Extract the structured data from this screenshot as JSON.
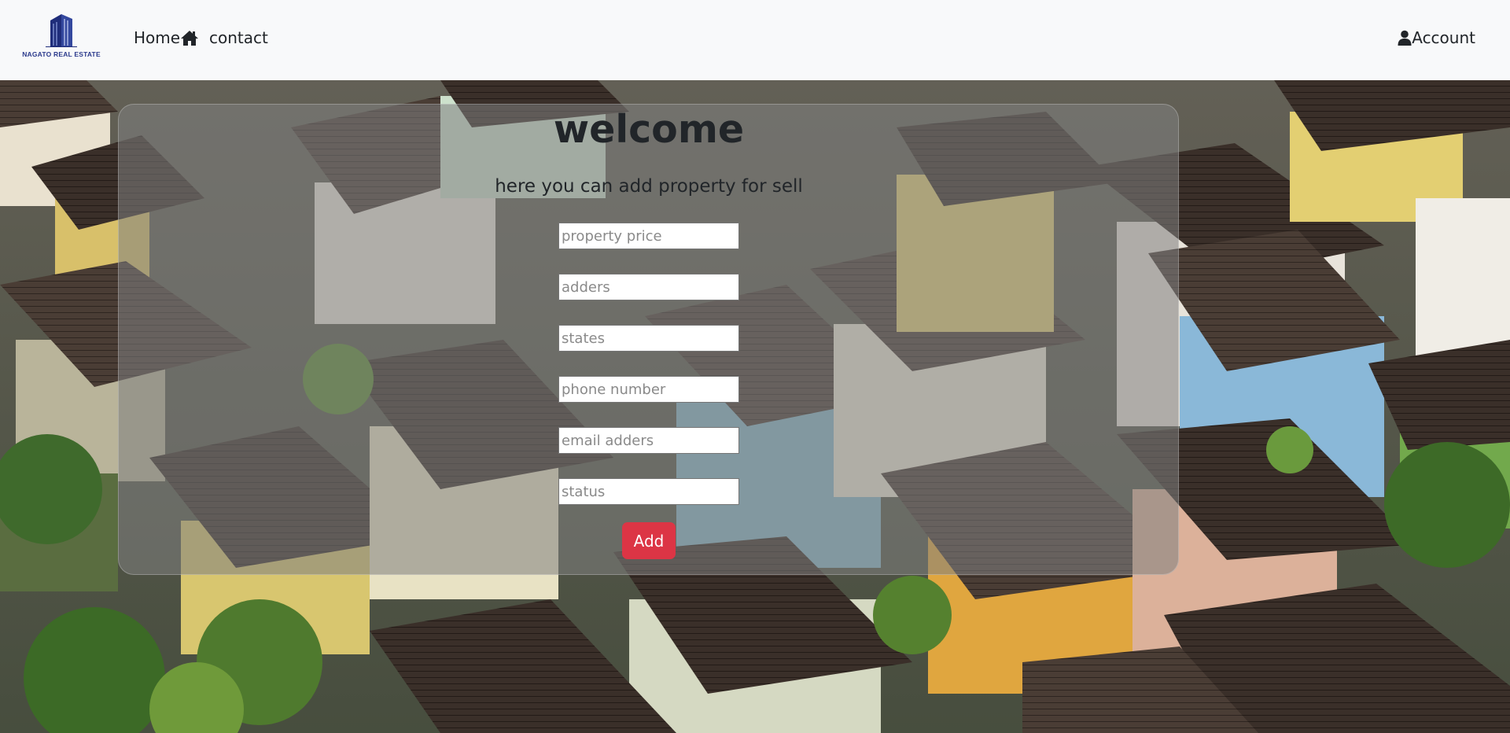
{
  "brand": {
    "name": "NAGATO REAL ESTATE",
    "color": "#2b3a8c"
  },
  "nav": {
    "home_label": "Home",
    "home_icon": "house-icon",
    "contact_label": "contact",
    "account_label": "Account",
    "account_icon": "user-icon"
  },
  "form": {
    "title": "welcome",
    "subtitle": "here you can add property for sell",
    "fields": [
      {
        "name": "property-price",
        "placeholder": "property price",
        "value": ""
      },
      {
        "name": "adders",
        "placeholder": "adders",
        "value": ""
      },
      {
        "name": "states",
        "placeholder": "states",
        "value": ""
      },
      {
        "name": "phone-number",
        "placeholder": "phone number",
        "value": ""
      },
      {
        "name": "email-adders",
        "placeholder": "email adders",
        "value": ""
      },
      {
        "name": "status",
        "placeholder": "status",
        "value": ""
      }
    ],
    "submit_label": "Add",
    "submit_color": "#dc3545"
  },
  "background": {
    "subject": "aerial-view-of-houses"
  }
}
